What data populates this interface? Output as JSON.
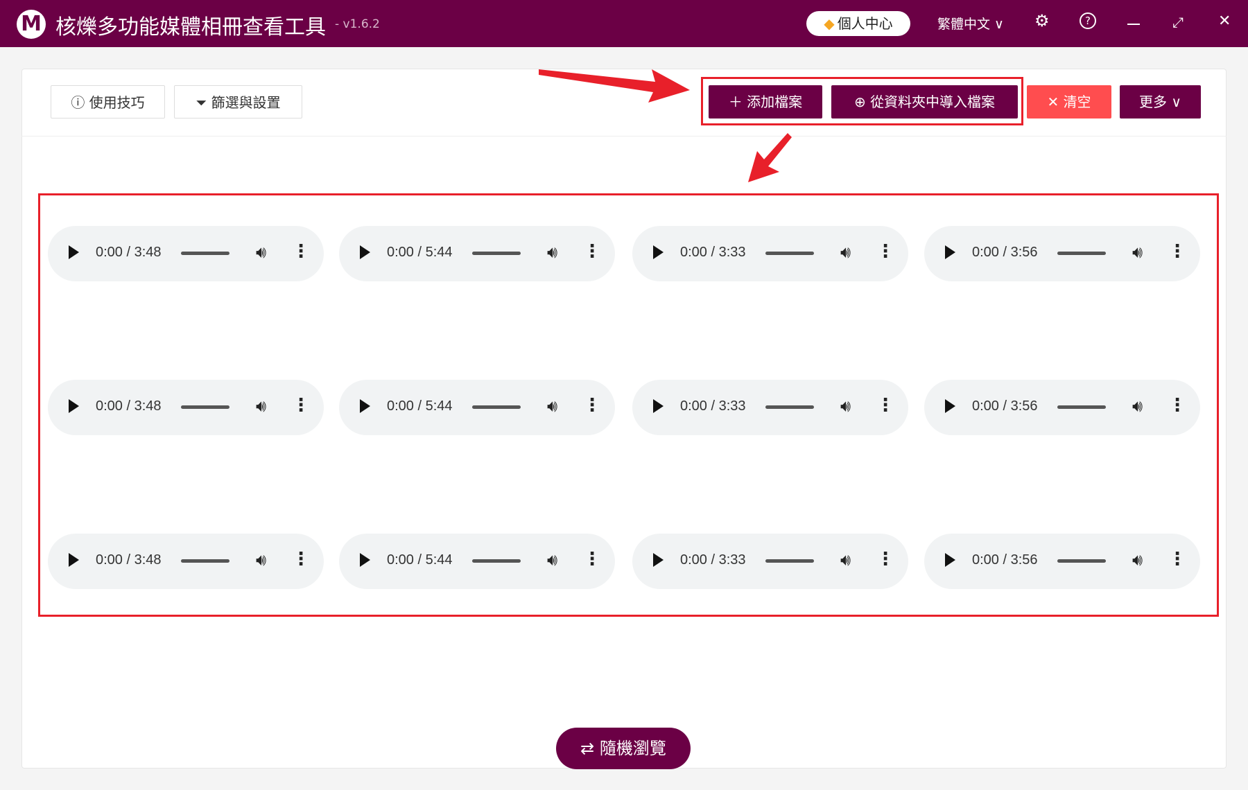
{
  "app": {
    "logo": "M",
    "title": "核爍多功能媒體相冊查看工具",
    "version": "- v1.6.2"
  },
  "titlebar": {
    "user_center": "個人中心",
    "language": "繁體中文 ∨",
    "settings_icon": "gear-icon",
    "help_icon": "help-icon"
  },
  "toolbar": {
    "tips": "使用技巧",
    "filter": "篩選與設置",
    "add_files": "添加檔案",
    "import_folder": "從資料夾中導入檔案",
    "clear": "清空",
    "more": "更多 ∨"
  },
  "players": [
    {
      "time": "0:00 / 3:48"
    },
    {
      "time": "0:00 / 5:44"
    },
    {
      "time": "0:00 / 3:33"
    },
    {
      "time": "0:00 / 3:56"
    },
    {
      "time": "0:00 / 3:48"
    },
    {
      "time": "0:00 / 5:44"
    },
    {
      "time": "0:00 / 3:33"
    },
    {
      "time": "0:00 / 3:56"
    },
    {
      "time": "0:00 / 3:48"
    },
    {
      "time": "0:00 / 5:44"
    },
    {
      "time": "0:00 / 3:33"
    },
    {
      "time": "0:00 / 3:56"
    }
  ],
  "footer": {
    "random_browse": "隨機瀏覽"
  },
  "colors": {
    "brand": "#6b0045",
    "danger": "#ff4d4f",
    "highlight": "#e8202a"
  }
}
